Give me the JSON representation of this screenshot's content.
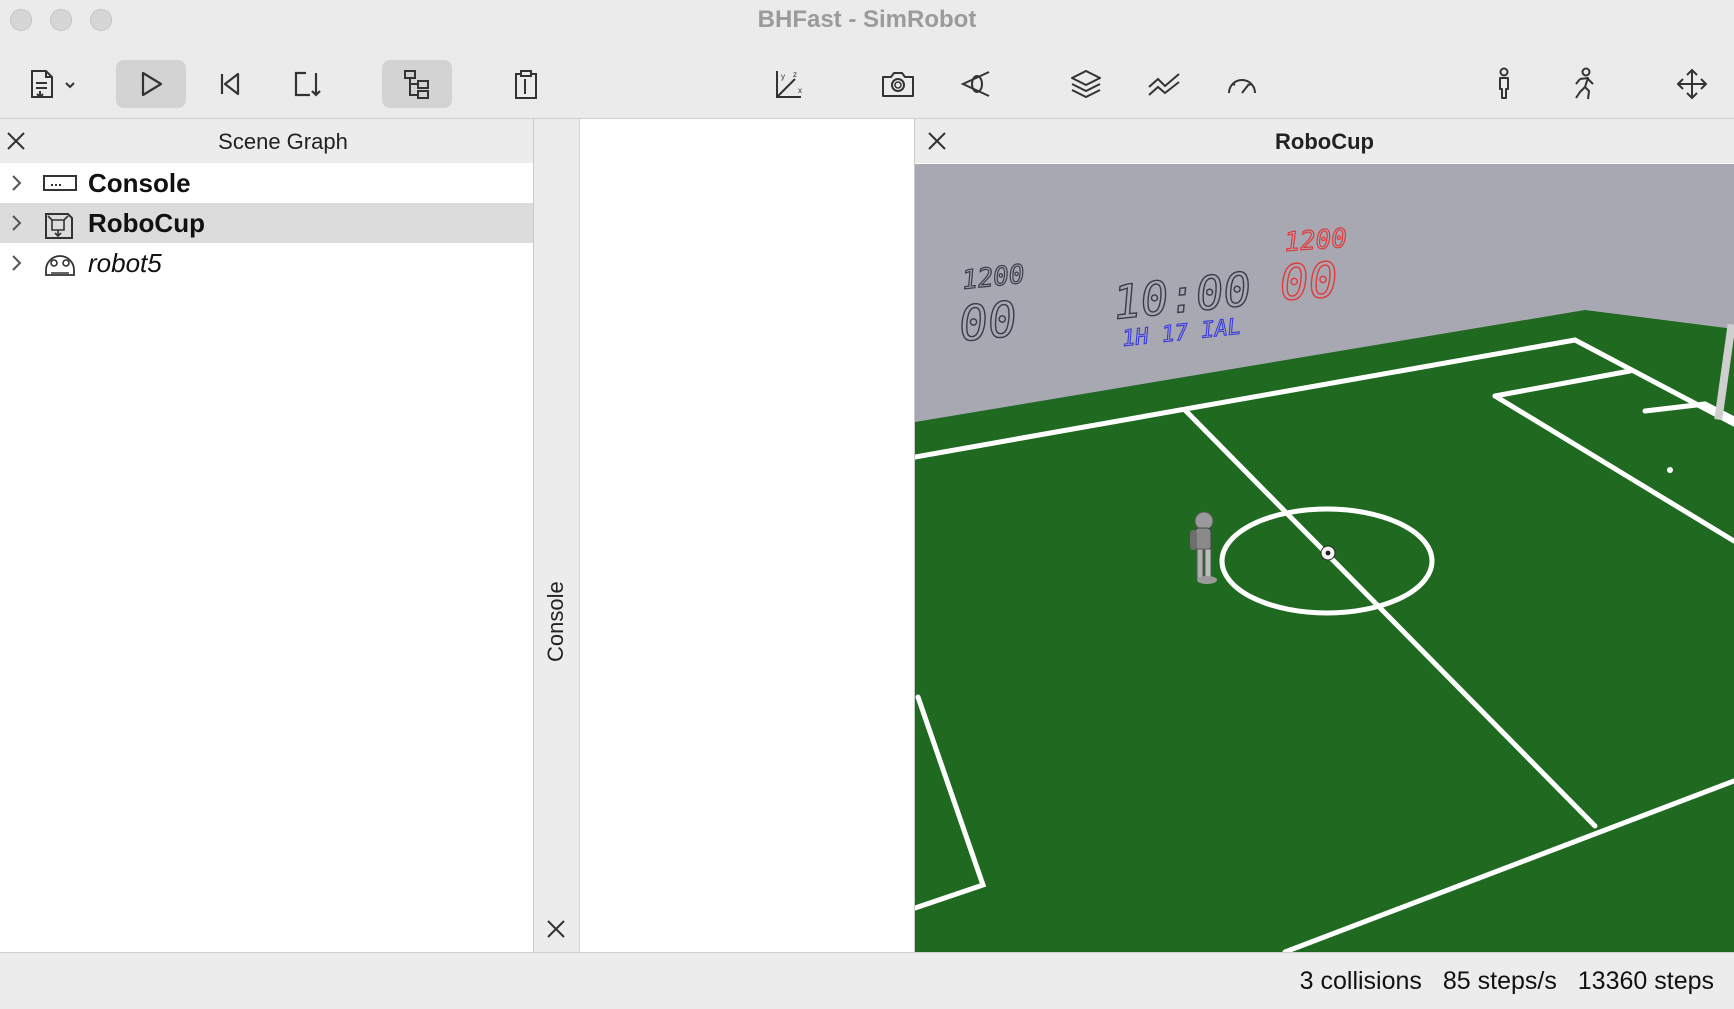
{
  "window": {
    "title": "BHFast - SimRobot"
  },
  "toolbar": {
    "items": [
      {
        "name": "open-file-dropdown-button",
        "icon": "document-icon"
      },
      {
        "name": "play-button",
        "icon": "play-icon",
        "active": true
      },
      {
        "name": "reset-button",
        "icon": "skip-back-icon"
      },
      {
        "name": "step-button",
        "icon": "step-icon"
      },
      {
        "name": "scene-graph-toggle-button",
        "icon": "tree-icon",
        "active": true
      },
      {
        "name": "clipboard-button",
        "icon": "clipboard-icon"
      },
      {
        "name": "axes-button",
        "icon": "axes-icon"
      },
      {
        "name": "screenshot-button",
        "icon": "camera-icon"
      },
      {
        "name": "view-camera-button",
        "icon": "eye-camera-icon"
      },
      {
        "name": "layers-button",
        "icon": "layers-icon"
      },
      {
        "name": "plot-button",
        "icon": "line-chart-icon"
      },
      {
        "name": "speed-button",
        "icon": "gauge-icon"
      },
      {
        "name": "robot-stand-button",
        "icon": "person-standing-icon"
      },
      {
        "name": "robot-walk-button",
        "icon": "person-walking-icon"
      },
      {
        "name": "move-button",
        "icon": "move-arrows-icon"
      }
    ]
  },
  "scene_graph": {
    "title": "Scene Graph",
    "items": [
      {
        "label": "Console",
        "icon": "console-icon",
        "bold": true,
        "selected": false
      },
      {
        "label": "RoboCup",
        "icon": "scene-icon",
        "bold": true,
        "selected": true
      },
      {
        "label": "robot5",
        "icon": "robot-icon",
        "bold": false,
        "selected": false
      }
    ]
  },
  "console_dock": {
    "label": "Console"
  },
  "view": {
    "title": "RoboCup",
    "scoreboard": {
      "left_time": "1200",
      "left_score": "00",
      "clock": "10:00",
      "half": "1H 17 IAL",
      "right_time": "1200",
      "right_score": "00"
    },
    "colors": {
      "field": "#1e6b1f",
      "wall": "#a9a9b4",
      "lines": "#ffffff",
      "left_team": "#3a3a4a",
      "half_text": "#3a3ae0",
      "right_team": "#e03a3a"
    }
  },
  "status": {
    "collisions": "3 collisions",
    "steps_per_second": "85 steps/s",
    "steps": "13360 steps"
  }
}
